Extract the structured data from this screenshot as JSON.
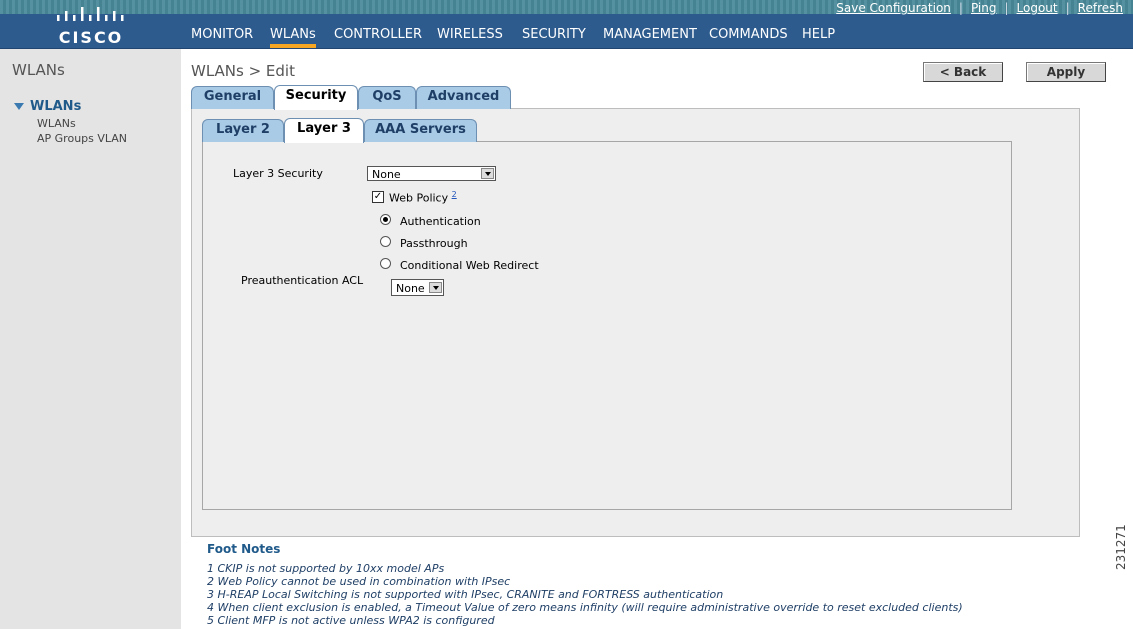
{
  "header": {
    "logo_text": "CISCO",
    "top_links": [
      "Save Configuration",
      "Ping",
      "Logout",
      "Refresh"
    ],
    "menu": [
      "MONITOR",
      "WLANs",
      "CONTROLLER",
      "WIRELESS",
      "SECURITY",
      "MANAGEMENT",
      "COMMANDS",
      "HELP"
    ],
    "active_menu": "WLANs",
    "colors": {
      "bar": "#2d5b8e",
      "active_underline": "#f5a623"
    }
  },
  "sidebar": {
    "title": "WLANs",
    "section": "WLANs",
    "items": [
      "WLANs",
      "AP Groups VLAN"
    ]
  },
  "main": {
    "title": "WLANs > Edit",
    "back_label": "< Back",
    "apply_label": "Apply",
    "tabs": [
      "General",
      "Security",
      "QoS",
      "Advanced"
    ],
    "active_tab": "Security",
    "subtabs": [
      "Layer 2",
      "Layer 3",
      "AAA Servers"
    ],
    "active_subtab": "Layer 3",
    "form": {
      "l3_security_label": "Layer 3 Security",
      "l3_security_value": "None",
      "web_policy_label": "Web Policy",
      "web_policy_note": "2",
      "web_policy_checked": true,
      "radio_options": [
        "Authentication",
        "Passthrough",
        "Conditional Web Redirect"
      ],
      "radio_selected": "Authentication",
      "preauth_acl_label": "Preauthentication ACL",
      "preauth_acl_value": "None"
    }
  },
  "footnotes": {
    "title": "Foot Notes",
    "items": [
      "1 CKIP is not supported by 10xx model APs",
      "2 Web Policy cannot be used in combination with IPsec",
      "3 H-REAP Local Switching is not supported with IPsec, CRANITE and FORTRESS authentication",
      "4 When client exclusion is enabled, a Timeout Value of zero means infinity (will require administrative override to reset excluded clients)",
      "5 Client MFP is not active unless WPA2 is configured"
    ]
  },
  "figure_number": "231271"
}
